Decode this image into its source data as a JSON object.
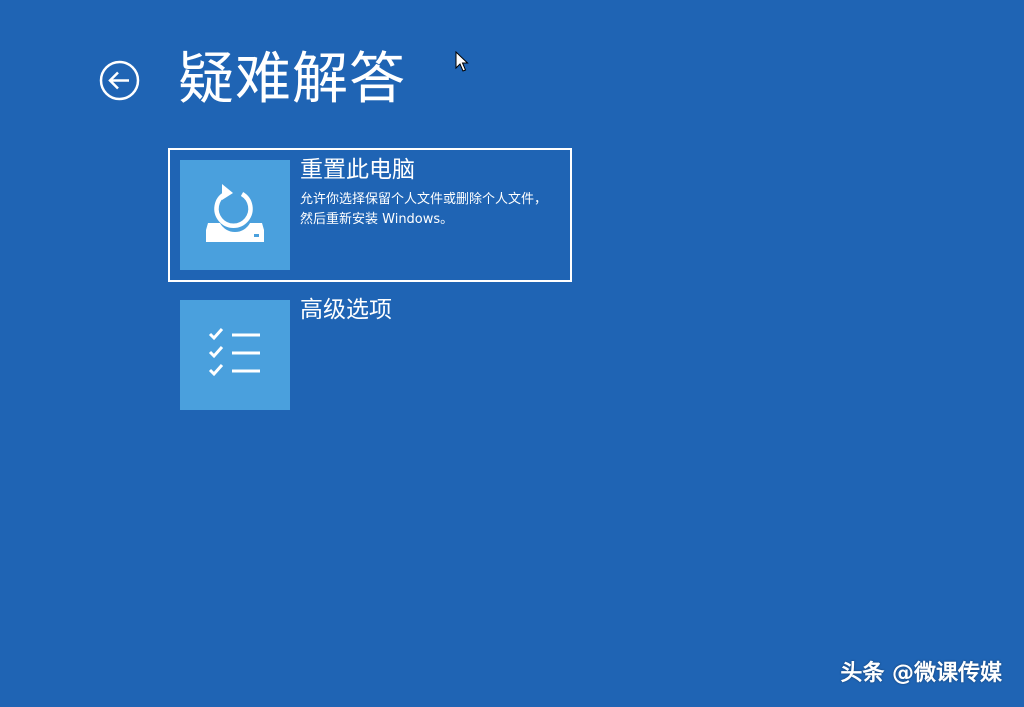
{
  "header": {
    "title": "疑难解答",
    "back_icon": "back-arrow-circle-icon"
  },
  "options": [
    {
      "title": "重置此电脑",
      "description": "允许你选择保留个人文件或删除个人文件，然后重新安装 Windows。",
      "icon": "reset-pc-icon",
      "selected": true
    },
    {
      "title": "高级选项",
      "description": "",
      "icon": "checklist-icon",
      "selected": false
    }
  ],
  "watermark": "头条 @微课传媒",
  "colors": {
    "background": "#1f64b4",
    "tile": "#4aa0dd",
    "text": "#ffffff"
  }
}
